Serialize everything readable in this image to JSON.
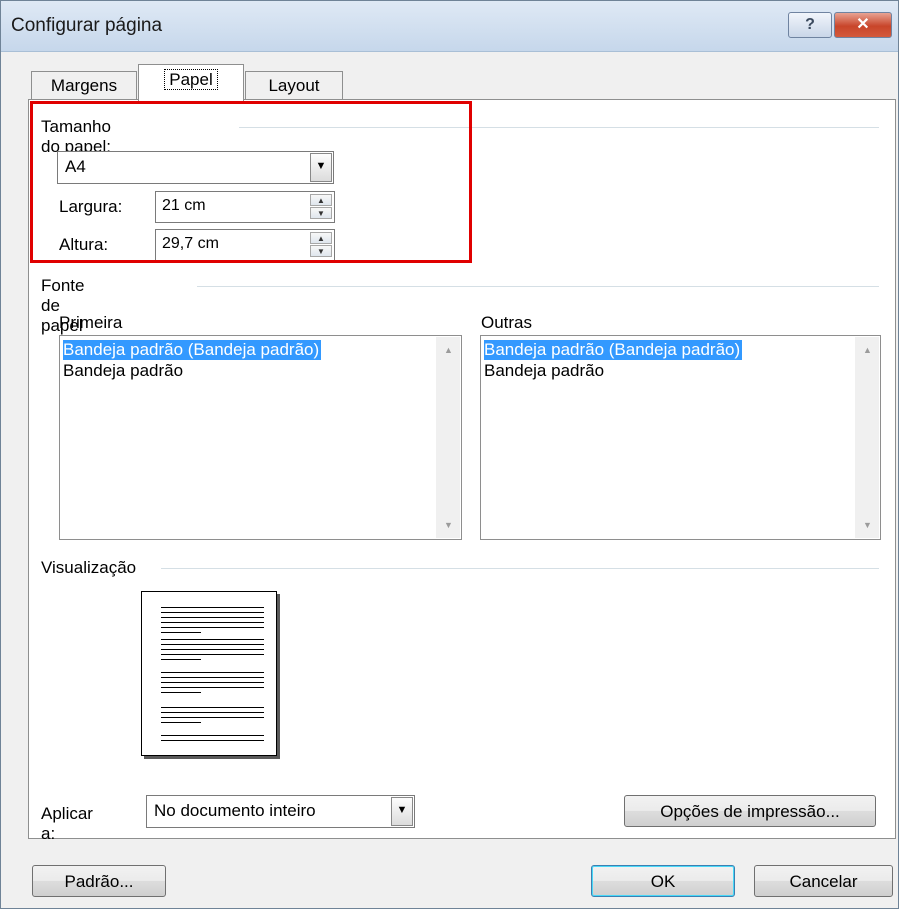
{
  "window": {
    "title": "Configurar página",
    "help": "?",
    "close": "✕"
  },
  "tabs": {
    "margens": "Margens",
    "papel": "Papel",
    "layout": "Layout"
  },
  "paper_size": {
    "group": "Tamanho do papel:",
    "selected": "A4",
    "width_label": "Largura:",
    "width_value": "21 cm",
    "height_label": "Altura:",
    "height_value": "29,7 cm"
  },
  "paper_source": {
    "group": "Fonte de papel",
    "first_label": "Primeira página:",
    "first_items": [
      "Bandeja padrão (Bandeja padrão)",
      "Bandeja padrão"
    ],
    "other_label": "Outras páginas:",
    "other_items": [
      "Bandeja padrão (Bandeja padrão)",
      "Bandeja padrão"
    ]
  },
  "preview": {
    "group": "Visualização"
  },
  "apply": {
    "label": "Aplicar a:",
    "selected": "No documento inteiro"
  },
  "buttons": {
    "print_options": "Opções de impressão...",
    "default": "Padrão...",
    "ok": "OK",
    "cancel": "Cancelar"
  }
}
